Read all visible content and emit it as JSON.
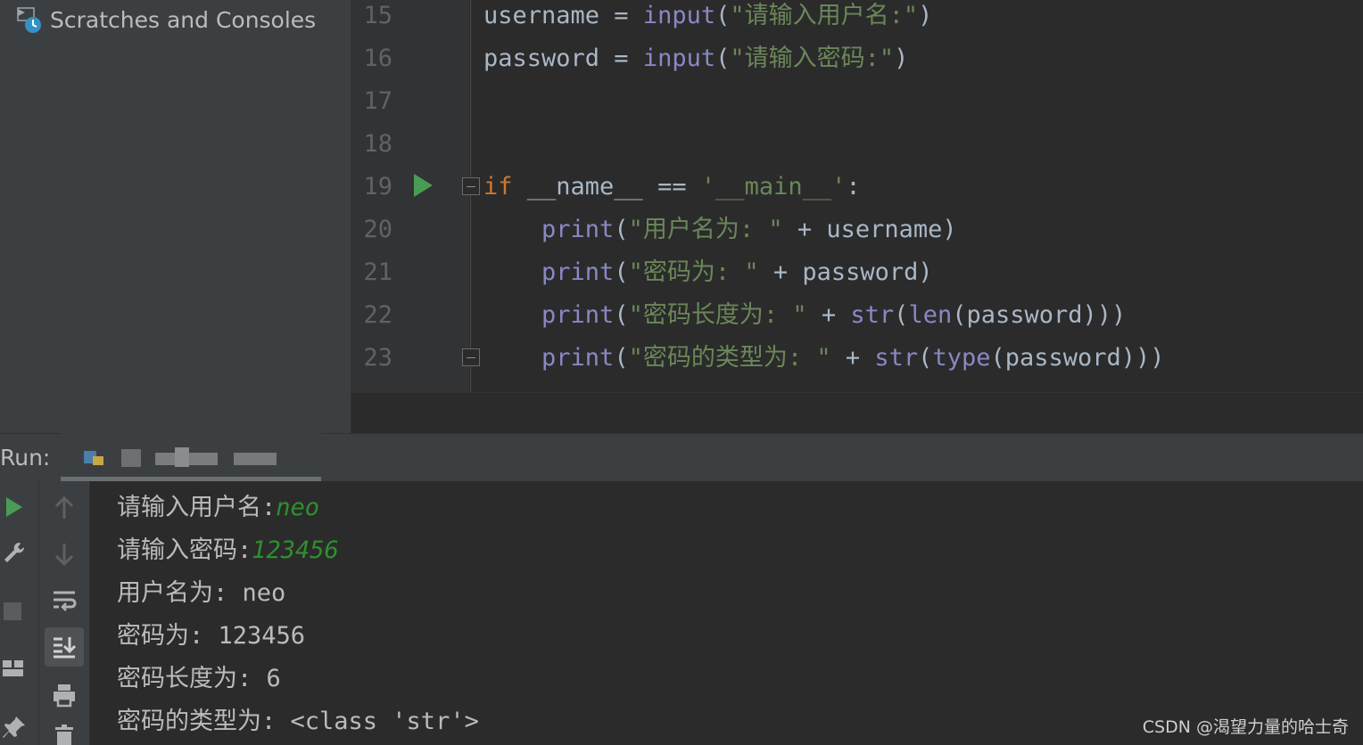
{
  "project_panel": {
    "scratches_label": "Scratches and Consoles"
  },
  "editor": {
    "lines": [
      {
        "num": "15",
        "parts": [
          {
            "t": "username = ",
            "c": ""
          },
          {
            "t": "input",
            "c": "fn"
          },
          {
            "t": "(",
            "c": ""
          },
          {
            "t": "\"请输入用户名:\"",
            "c": "str"
          },
          {
            "t": ")",
            "c": ""
          }
        ]
      },
      {
        "num": "16",
        "parts": [
          {
            "t": "password = ",
            "c": ""
          },
          {
            "t": "input",
            "c": "fn"
          },
          {
            "t": "(",
            "c": ""
          },
          {
            "t": "\"请输入密码:\"",
            "c": "str"
          },
          {
            "t": ")",
            "c": ""
          }
        ]
      },
      {
        "num": "17",
        "parts": []
      },
      {
        "num": "18",
        "parts": []
      },
      {
        "num": "19",
        "parts": [
          {
            "t": "if",
            "c": "kw"
          },
          {
            "t": " __name__ == ",
            "c": ""
          },
          {
            "t": "'__main__'",
            "c": "str"
          },
          {
            "t": ":",
            "c": ""
          }
        ]
      },
      {
        "num": "20",
        "parts": [
          {
            "t": "    ",
            "c": ""
          },
          {
            "t": "print",
            "c": "fn"
          },
          {
            "t": "(",
            "c": ""
          },
          {
            "t": "\"用户名为: \"",
            "c": "str"
          },
          {
            "t": " + username)",
            "c": ""
          }
        ]
      },
      {
        "num": "21",
        "parts": [
          {
            "t": "    ",
            "c": ""
          },
          {
            "t": "print",
            "c": "fn"
          },
          {
            "t": "(",
            "c": ""
          },
          {
            "t": "\"密码为: \"",
            "c": "str"
          },
          {
            "t": " + password)",
            "c": ""
          }
        ]
      },
      {
        "num": "22",
        "parts": [
          {
            "t": "    ",
            "c": ""
          },
          {
            "t": "print",
            "c": "fn"
          },
          {
            "t": "(",
            "c": ""
          },
          {
            "t": "\"密码长度为: \"",
            "c": "str"
          },
          {
            "t": " + ",
            "c": ""
          },
          {
            "t": "str",
            "c": "fn"
          },
          {
            "t": "(",
            "c": ""
          },
          {
            "t": "len",
            "c": "fn"
          },
          {
            "t": "(password)))",
            "c": ""
          }
        ]
      },
      {
        "num": "23",
        "parts": [
          {
            "t": "    ",
            "c": ""
          },
          {
            "t": "print",
            "c": "fn"
          },
          {
            "t": "(",
            "c": ""
          },
          {
            "t": "\"密码的类型为: \"",
            "c": "str"
          },
          {
            "t": " + ",
            "c": ""
          },
          {
            "t": "str",
            "c": "fn"
          },
          {
            "t": "(",
            "c": ""
          },
          {
            "t": "type",
            "c": "fn"
          },
          {
            "t": "(password)))",
            "c": ""
          }
        ]
      }
    ]
  },
  "run": {
    "label": "Run:",
    "console": [
      {
        "prompt": "请输入用户名:",
        "input": "neo"
      },
      {
        "prompt": "请输入密码:",
        "input": "123456"
      },
      {
        "prompt": "用户名为: neo",
        "input": ""
      },
      {
        "prompt": "密码为: 123456",
        "input": ""
      },
      {
        "prompt": "密码长度为: 6",
        "input": ""
      },
      {
        "prompt": "密码的类型为: <class 'str'>",
        "input": ""
      }
    ]
  },
  "watermark": "CSDN @渴望力量的哈士奇",
  "colors": {
    "keyword": "#cc7832",
    "string": "#6a8759",
    "builtin": "#8888c6",
    "text": "#a9b7c6",
    "user_input": "#2f8f2f",
    "run_icon": "#499c54"
  }
}
